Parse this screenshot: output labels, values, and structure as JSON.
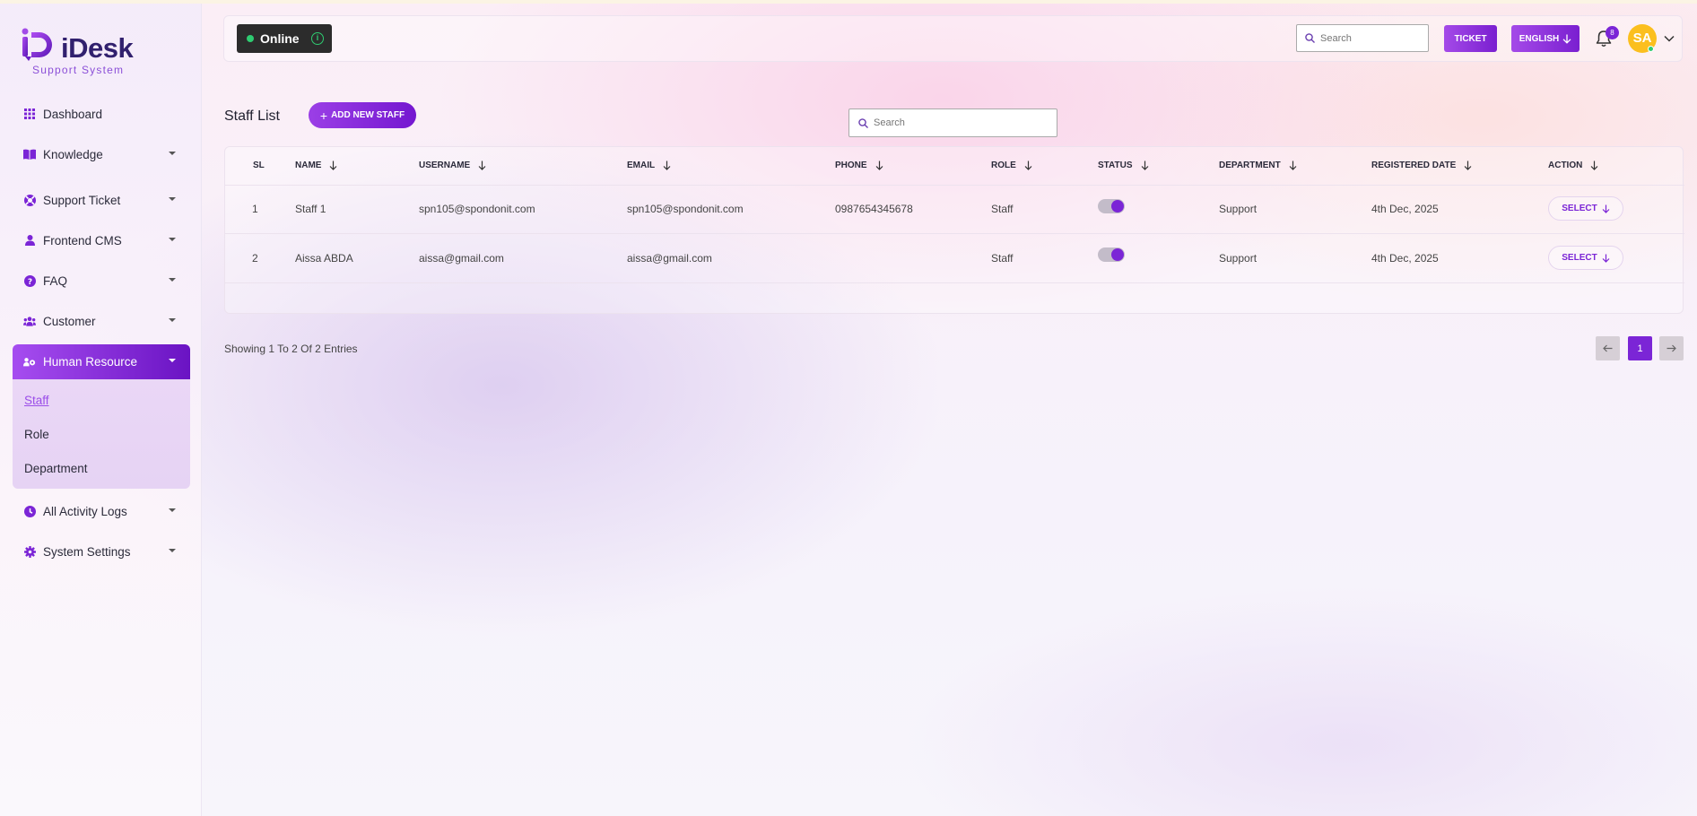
{
  "brand": {
    "name": "iDesk",
    "tagline": "Support System"
  },
  "sidebar": {
    "items": [
      {
        "label": "Dashboard",
        "icon": "grid-icon",
        "caret": false
      },
      {
        "label": "Knowledge",
        "icon": "book-icon",
        "caret": true
      },
      {
        "label": "Support Ticket",
        "icon": "lifering-icon",
        "caret": true
      },
      {
        "label": "Frontend CMS",
        "icon": "user-icon",
        "caret": true
      },
      {
        "label": "FAQ",
        "icon": "question-icon",
        "caret": true
      },
      {
        "label": "Customer",
        "icon": "users-icon",
        "caret": true
      },
      {
        "label": "Human Resource",
        "icon": "people-gear-icon",
        "caret": true,
        "active": true
      },
      {
        "label": "All Activity Logs",
        "icon": "clock-icon",
        "caret": true
      },
      {
        "label": "System Settings",
        "icon": "gear-icon",
        "caret": true
      }
    ],
    "submenu": [
      "Staff",
      "Role",
      "Department"
    ],
    "submenu_current": "Staff"
  },
  "topbar": {
    "status": "Online",
    "search_placeholder": "Search",
    "ticket_label": "TICKET",
    "language_label": "ENGLISH",
    "notification_count": "8",
    "avatar_initials": "SA"
  },
  "content": {
    "title": "Staff List",
    "add_button": "ADD NEW STAFF",
    "search_placeholder": "Search",
    "columns": [
      "SL",
      "NAME",
      "USERNAME",
      "EMAIL",
      "PHONE",
      "ROLE",
      "STATUS",
      "DEPARTMENT",
      "REGISTERED DATE",
      "ACTION"
    ],
    "rows": [
      {
        "sl": "1",
        "name": "Staff 1",
        "username": "spn105@spondonit.com",
        "email": "spn105@spondonit.com",
        "phone": "0987654345678",
        "role": "Staff",
        "status": true,
        "department": "Support",
        "registered": "4th Dec, 2025",
        "action": "SELECT"
      },
      {
        "sl": "2",
        "name": "Aissa ABDA",
        "username": "aissa@gmail.com",
        "email": "aissa@gmail.com",
        "phone": "",
        "role": "Staff",
        "status": true,
        "department": "Support",
        "registered": "4th Dec, 2025",
        "action": "SELECT"
      }
    ],
    "entries_text": "Showing 1 To 2 Of 2 Entries",
    "current_page": "1"
  },
  "colors": {
    "accent": "#7b25d6",
    "accent_light": "#a64df0",
    "online": "#2ecc71",
    "avatar": "#fbbf1e"
  }
}
